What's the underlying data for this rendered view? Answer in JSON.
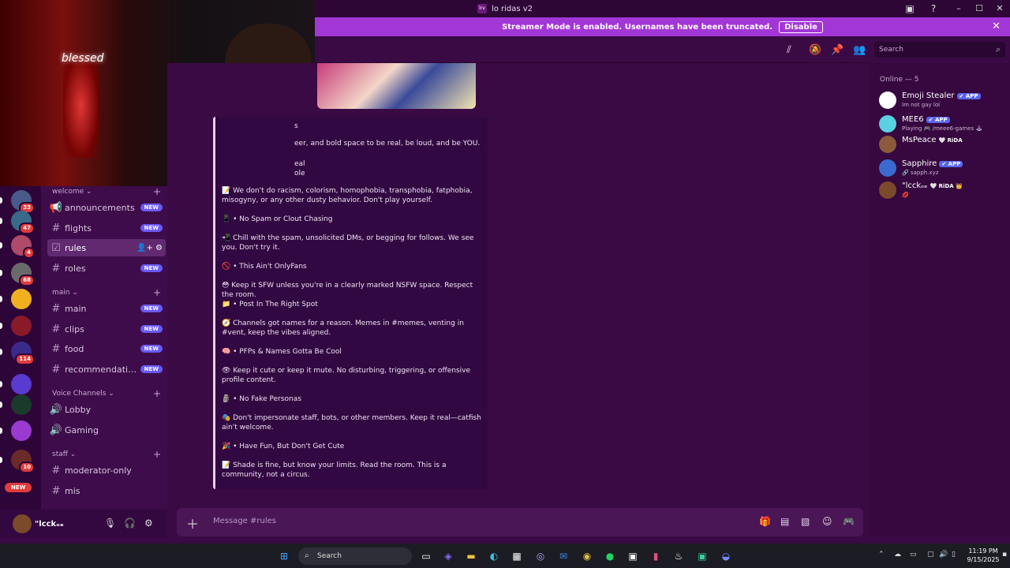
{
  "window": {
    "title": "lo ridas v2",
    "app_icon": "lrv"
  },
  "banner": {
    "text": "Streamer Mode is enabled. Usernames have been truncated.",
    "disable_label": "Disable"
  },
  "webcam": {
    "neon_text": "blessed"
  },
  "servers": [
    {
      "badge": "33",
      "color": "#4a5a8a"
    },
    {
      "badge": "47",
      "color": "#3a6a8a"
    },
    {
      "badge": "4",
      "color": "#b04a6a"
    },
    {
      "badge": "68",
      "color": "#6a6a6a"
    },
    {
      "badge": "",
      "color": "#f0b020"
    },
    {
      "badge": "",
      "color": "#8a1a2a"
    },
    {
      "badge": "114",
      "color": "#3a2a8a"
    },
    {
      "badge": "",
      "color": "#5a3ad0"
    },
    {
      "badge": "",
      "color": "#1a3a2a"
    },
    {
      "badge": "",
      "color": "#9a3ad0"
    },
    {
      "badge": "10",
      "color": "#6a2a2a"
    }
  ],
  "new_pill": "NEW",
  "sidebar": {
    "categories": [
      {
        "name": "welcome",
        "channels": [
          {
            "label": "announcements",
            "icon": "megaphone-icon",
            "new": "NEW"
          },
          {
            "label": "flights",
            "icon": "hash-icon",
            "new": "NEW"
          },
          {
            "label": "rules",
            "icon": "rules-icon",
            "new": "",
            "selected": true
          },
          {
            "label": "roles",
            "icon": "hash-icon",
            "new": "NEW"
          }
        ]
      },
      {
        "name": "main",
        "channels": [
          {
            "label": "main",
            "icon": "hash-icon",
            "new": "NEW"
          },
          {
            "label": "clips",
            "icon": "hash-icon",
            "new": "NEW"
          },
          {
            "label": "food",
            "icon": "hash-icon",
            "new": "NEW"
          },
          {
            "label": "recommendations",
            "icon": "hash-icon",
            "new": "NEW"
          }
        ]
      },
      {
        "name": "Voice Channels",
        "channels": [
          {
            "label": "Lobby",
            "icon": "speaker-icon",
            "new": ""
          },
          {
            "label": "Gaming",
            "icon": "speaker-icon",
            "new": ""
          }
        ]
      },
      {
        "name": "staff",
        "channels": [
          {
            "label": "moderator-only",
            "icon": "hash-icon",
            "new": ""
          },
          {
            "label": "mis",
            "icon": "hash-icon",
            "new": ""
          }
        ]
      }
    ]
  },
  "user": {
    "name": "\"lcckₒₑ"
  },
  "search": {
    "placeholder": "Search"
  },
  "rules": [
    {
      "text": "s"
    },
    {
      "text": "eer, and bold space to be real, be loud, and be YOU."
    },
    {
      "text": "eal"
    },
    {
      "text": "ole"
    },
    {
      "text": "📝 We don't do racism, colorism, homophobia, transphobia, fatphobia, misogyny, or any other dusty behavior. Don't play yourself."
    },
    {
      "text": "📱 • No Spam or Clout Chasing"
    },
    {
      "text": "📲 Chill with the spam, unsolicited DMs, or begging for follows. We see you. Don't try it."
    },
    {
      "text": "🚫 • This Ain't OnlyFans"
    },
    {
      "text": "😳 Keep it SFW unless you're in a clearly marked NSFW space. Respect the room."
    },
    {
      "text": "📁 • Post In The Right Spot"
    },
    {
      "text": "🧭 Channels got names for a reason. Memes in #memes, venting in #vent, keep the vibes aligned."
    },
    {
      "text": "🧠 • PFPs & Names Gotta Be Cool"
    },
    {
      "text": "👁 Keep it cute or keep it mute. No disturbing, triggering, or offensive profile content."
    },
    {
      "text": "🗿 • No Fake Personas"
    },
    {
      "text": "🎭 Don't impersonate staff, bots, or other members. Keep it real—catfish ain't welcome."
    },
    {
      "text": "🎉 • Have Fun, But Don't Get Cute"
    },
    {
      "text": "📝 Shade is fine, but know your limits. Read the room. This is a community, not a circus."
    }
  ],
  "composer": {
    "placeholder": "Message #rules"
  },
  "members": {
    "header": "Online — 5",
    "list": [
      {
        "name": "Emoji Stealer",
        "badge": "✔ APP",
        "sub": "Im not gay lol",
        "color": "#ffffff"
      },
      {
        "name": "MEE6",
        "badge": "✔ APP",
        "sub": "Playing 🎮 /meee6-games 🕹",
        "color": "#5ad0e0"
      },
      {
        "name": "MsPeace",
        "badge": "",
        "tag": "🤍 RiDA",
        "sub": "",
        "color": "#8a5a3a"
      },
      {
        "name": "Sapphire",
        "badge": "✔ APP",
        "sub": "🔗 sapph.xyz",
        "color": "#3a6ad0"
      },
      {
        "name": "\"lcckₒₑ",
        "badge": "",
        "tag": "🤍 RiDA 👑",
        "sub": "💋",
        "color": "#7a4a2a"
      }
    ]
  },
  "taskbar": {
    "search": "Search",
    "time": "11:19 PM",
    "date": "9/15/2025"
  }
}
